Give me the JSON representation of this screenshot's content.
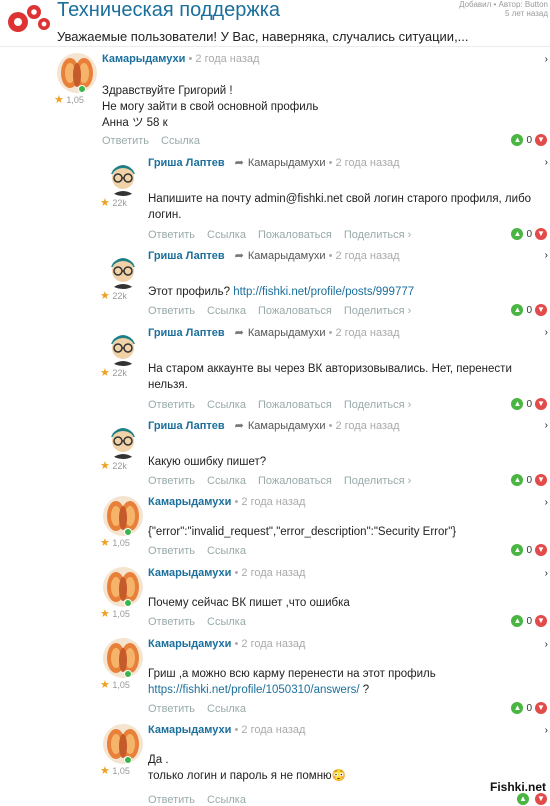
{
  "header": {
    "title": "Техническая поддержка",
    "subtitle": "Уважаемые пользователи! У Вас, наверняка, случались ситуации,...",
    "meta_line1": "Добавил • Автор: Button",
    "meta_line2": "5 лет назад"
  },
  "comments": [
    {
      "author": "Камарыдамухи",
      "time": "• 2 года назад",
      "reply_to": "",
      "karma": "1,05",
      "text": [
        "Здравствуйте Григорий !",
        "Не могу зайти в свой основной профиль",
        "Анна ツ 58 к"
      ],
      "actions": [
        "Ответить",
        "Ссылка"
      ],
      "up": "0"
    },
    {
      "author": "Гриша Лаптев",
      "time": "• 2 года назад",
      "reply_to": "Камарыдамухи",
      "karma": "22k",
      "text": [
        "Напишите на почту admin@fishki.net свой логин старого профиля, либо",
        "логин."
      ],
      "actions": [
        "Ответить",
        "Ссылка",
        "Пожаловаться",
        "Поделиться ›"
      ],
      "up": "0"
    },
    {
      "author": "Гриша Лаптев",
      "time": "• 2 года назад",
      "reply_to": "Камарыдамухи",
      "karma": "22k",
      "text_prefix": "Этот профиль?",
      "link": "http://fishki.net/profile/posts/999777",
      "actions": [
        "Ответить",
        "Ссылка",
        "Пожаловаться",
        "Поделиться ›"
      ],
      "up": "0"
    },
    {
      "author": "Гриша Лаптев",
      "time": "• 2 года назад",
      "reply_to": "Камарыдамухи",
      "karma": "22k",
      "text": [
        "На старом аккаунте вы через ВК авторизовывались. Нет, перенести",
        "нельзя."
      ],
      "actions": [
        "Ответить",
        "Ссылка",
        "Пожаловаться",
        "Поделиться ›"
      ],
      "up": "0"
    },
    {
      "author": "Гриша Лаптев",
      "time": "• 2 года назад",
      "reply_to": "Камарыдамухи",
      "karma": "22k",
      "text": [
        "Какую ошибку пишет?"
      ],
      "actions": [
        "Ответить",
        "Ссылка",
        "Пожаловаться",
        "Поделиться ›"
      ],
      "up": "0"
    },
    {
      "author": "Камарыдамухи",
      "time": "• 2 года назад",
      "reply_to": "",
      "karma": "1,05",
      "text": [
        "{\"error\":\"invalid_request\",\"error_description\":\"Security Error\"}"
      ],
      "actions": [
        "Ответить",
        "Ссылка"
      ],
      "up": "0"
    },
    {
      "author": "Камарыдамухи",
      "time": "• 2 года назад",
      "reply_to": "",
      "karma": "1,05",
      "text": [
        "Почему сейчас ВК пишет ,что ошибка"
      ],
      "actions": [
        "Ответить",
        "Ссылка"
      ],
      "up": "0"
    },
    {
      "author": "Камарыдамухи",
      "time": "• 2 года назад",
      "reply_to": "",
      "karma": "1,05",
      "text_prefix": "Гриш ,а можно всю карму перенести на этот профиль",
      "link": "https://fishki.net/profile/1050310/answers/",
      "text_suffix": " ?",
      "actions": [
        "Ответить",
        "Ссылка"
      ],
      "up": "0"
    },
    {
      "author": "Камарыдамухи",
      "time": "• 2 года назад",
      "reply_to": "",
      "karma": "1,05",
      "text": [
        "Да .",
        "только логин и пароль я не помню😳"
      ],
      "actions": [
        "Ответить",
        "Ссылка"
      ],
      "up": ""
    }
  ],
  "watermark": "Fishki.net",
  "colors": {
    "accent": "#1b6f9c",
    "upvote": "#4bb543",
    "downvote": "#e34a4a",
    "online": "#3ab54a"
  }
}
